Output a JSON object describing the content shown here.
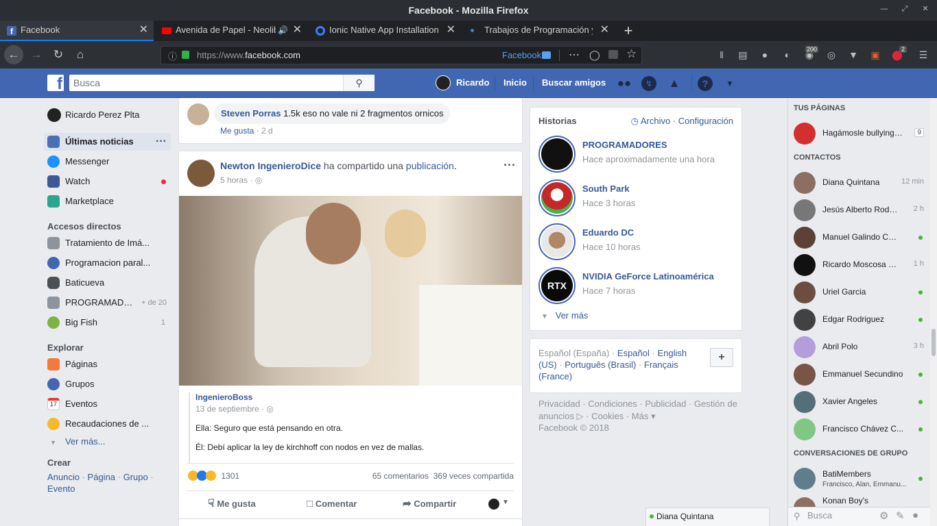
{
  "window": {
    "title": "Facebook - Mozilla Firefox"
  },
  "tabs": [
    {
      "label": "Facebook",
      "color": "#4267b2"
    },
    {
      "label": "Avenida de Papel - Neoliberal",
      "color": "#ff0000"
    },
    {
      "label": "Ionic Native App Installation w",
      "color": "#3880ff"
    },
    {
      "label": "Trabajos de Programación y T",
      "color": "#3b82c4"
    }
  ],
  "nav": {
    "url_prefix": "https://www.",
    "url_domain": "facebook.com",
    "container": "Facebook",
    "addon_badge": "200",
    "adblock_badge": "2"
  },
  "fbheader": {
    "search_placeholder": "Busca",
    "user": "Ricardo",
    "home": "Inicio",
    "find_friends": "Buscar amigos"
  },
  "left": {
    "profile": "Ricardo Perez Plta",
    "main": [
      {
        "label": "Últimas noticias",
        "icon": "news-feed-icon"
      },
      {
        "label": "Messenger",
        "icon": "messenger-icon"
      },
      {
        "label": "Watch",
        "icon": "watch-icon"
      },
      {
        "label": "Marketplace",
        "icon": "marketplace-icon"
      }
    ],
    "shortcuts_title": "Accesos directos",
    "shortcuts": [
      {
        "label": "Tratamiento de Imá...",
        "count": ""
      },
      {
        "label": "Programacion paral...",
        "count": ""
      },
      {
        "label": "Baticueva",
        "count": ""
      },
      {
        "label": "PROGRAMADO...",
        "count": "+ de 20"
      },
      {
        "label": "Big Fish",
        "count": "1"
      }
    ],
    "explore_title": "Explorar",
    "explore": [
      {
        "label": "Páginas"
      },
      {
        "label": "Grupos"
      },
      {
        "label": "Eventos",
        "badge": "17"
      },
      {
        "label": "Recaudaciones de ..."
      }
    ],
    "see_more": "Ver más...",
    "create_title": "Crear",
    "create_links": [
      "Anuncio",
      "Página",
      "Grupo",
      "Evento"
    ]
  },
  "feed": {
    "comment": {
      "author": "Steven Porras",
      "text": "1.5k eso no vale ni 2 fragmentos ornicos",
      "like": "Me gusta",
      "time": "2 d"
    },
    "post": {
      "author": "Newton IngenieroDice",
      "action_pre": "ha compartido una",
      "action_link": "publicación",
      "action_post": ".",
      "time": "5 horas",
      "shared_author": "IngenieroBoss",
      "shared_date": "13 de septiembre",
      "line1": "Ella: Seguro que está pensando en otra.",
      "line2": "Él: Debí aplicar la ley de kirchhoff con nodos en vez de mallas.",
      "reactions": "1301",
      "comments": "65 comentarios",
      "shares": "369 veces compartida",
      "btn_like": "Me gusta",
      "btn_comment": "Comentar",
      "btn_share": "Compartir"
    }
  },
  "stories": {
    "title": "Historias",
    "archive": "Archivo",
    "settings": "Configuración",
    "items": [
      {
        "name": "PROGRAMADORES",
        "time": "Hace aproximadamente una hora",
        "color": "#111111"
      },
      {
        "name": "South Park",
        "time": "Hace 3 horas",
        "color": "#c62828"
      },
      {
        "name": "Eduardo DC",
        "time": "Hace 10 horas",
        "color": "#6d5a4c"
      },
      {
        "name": "NVIDIA GeForce Latinoamérica",
        "time": "Hace 7 horas",
        "color": "#0a0a0a",
        "logo": "RTX"
      }
    ],
    "see_more": "Ver más"
  },
  "languages": {
    "current": "Español (España)",
    "links": [
      "Español",
      "English (US)",
      "Português (Brasil)",
      "Français (France)"
    ]
  },
  "footer": {
    "links": [
      "Privacidad",
      "Condiciones",
      "Publicidad",
      "Gestión de anuncios",
      "Cookies",
      "Más"
    ],
    "copyright": "Facebook © 2018"
  },
  "right": {
    "pages_title": "TUS PÁGINAS",
    "page": {
      "name": "Hagámosle bullying a...",
      "count": "9"
    },
    "contacts_title": "CONTACTOS",
    "contacts": [
      {
        "name": "Diana Quintana",
        "time": "12 min",
        "online": false,
        "color": "#8d6e63"
      },
      {
        "name": "Jesús Alberto Rodrí...",
        "time": "2 h",
        "online": false,
        "color": "#777777"
      },
      {
        "name": "Manuel Galindo Casi...",
        "time": "",
        "online": true,
        "color": "#5d4037"
      },
      {
        "name": "Ricardo Moscosa Vi...",
        "time": "1 h",
        "online": false,
        "color": "#111111"
      },
      {
        "name": "Uriel Garcia",
        "time": "",
        "online": true,
        "color": "#6d4c41"
      },
      {
        "name": "Edgar Rodriguez",
        "time": "",
        "online": true,
        "color": "#424242"
      },
      {
        "name": "Abril Polo",
        "time": "3 h",
        "online": false,
        "color": "#b39ddb"
      },
      {
        "name": "Emmanuel Secundino",
        "time": "",
        "online": true,
        "color": "#795548"
      },
      {
        "name": "Xavier Angeles",
        "time": "",
        "online": true,
        "color": "#546e7a"
      },
      {
        "name": "Francisco Chávez C...",
        "time": "",
        "online": true,
        "color": "#81c784"
      }
    ],
    "groups_title": "CONVERSACIONES DE GRUPO",
    "groups": [
      {
        "name": "BatiMembers",
        "members": "Francisco, Alan, Emmanu...",
        "online": true
      },
      {
        "name": "Konan Boy's",
        "members": "",
        "online": false
      }
    ],
    "chat_search": "Busca",
    "chat_tab": "Diana Quintana"
  },
  "colors": {
    "brand": "#4267b2",
    "link": "#365899",
    "online": "#42b72a"
  }
}
